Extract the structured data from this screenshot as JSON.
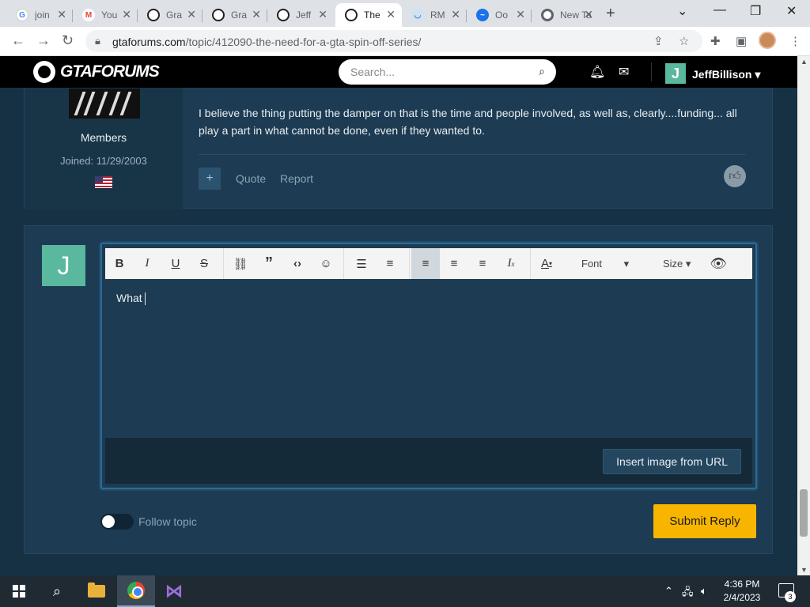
{
  "browser": {
    "tabs": [
      {
        "favicon": "google-icon",
        "title": "join"
      },
      {
        "favicon": "gmail-icon",
        "title": "You"
      },
      {
        "favicon": "gtaforums-icon",
        "title": "Gra"
      },
      {
        "favicon": "gtaforums-icon",
        "title": "Gra"
      },
      {
        "favicon": "gtaforums-icon",
        "title": "Jeff"
      },
      {
        "favicon": "gtaforums-icon",
        "title": "The",
        "active": true
      },
      {
        "favicon": "rm-icon",
        "title": "RM"
      },
      {
        "favicon": "edge-icon",
        "title": "Oo"
      },
      {
        "favicon": "chrome-newtab-icon",
        "title": "New Ta"
      }
    ],
    "url_domain": "gtaforums.com",
    "url_path": "/topic/412090-the-need-for-a-gta-spin-off-series/"
  },
  "site": {
    "logo_text": "GTAFORUMS",
    "search_placeholder": "Search...",
    "username": "JeffBillison",
    "user_initial": "J"
  },
  "post": {
    "author_group": "Members",
    "author_joined": "Joined: 11/29/2003",
    "body": "I believe the thing putting the damper on that is the time and people involved, as well as, clearly....funding... all play a part in what cannot be done, even if they wanted to.",
    "actions": {
      "quote": "Quote",
      "report": "Report"
    }
  },
  "reply": {
    "avatar_initial": "J",
    "toolbar": {
      "font_label": "Font",
      "size_label": "Size"
    },
    "editor_text": "What",
    "insert_image_label": "Insert image from URL",
    "follow_label": "Follow topic",
    "follow_on": false,
    "submit_label": "Submit Reply"
  },
  "taskbar": {
    "time": "4:36 PM",
    "date": "2/4/2023",
    "notification_count": "3"
  },
  "colors": {
    "page_bg": "#173144",
    "panel_bg": "#1d3b52",
    "accent_yellow": "#f7b500",
    "avatar_green": "#5ab89e"
  }
}
